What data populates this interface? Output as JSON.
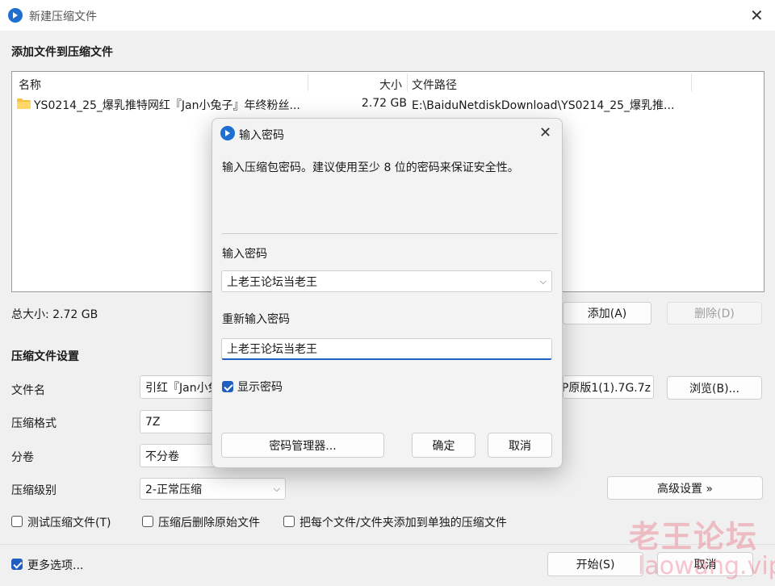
{
  "window": {
    "title": "新建压缩文件"
  },
  "section_add": {
    "title": "添加文件到压缩文件"
  },
  "file_list": {
    "columns": {
      "name": "名称",
      "size": "大小",
      "path": "文件路径"
    },
    "rows": [
      {
        "name": "YS0214_25_爆乳推特网红『Jan小兔子』年终粉丝...",
        "size": "2.72 GB",
        "path": "E:\\BaiduNetdiskDownload\\YS0214_25_爆乳推..."
      }
    ]
  },
  "total_size": "总大小: 2.72 GB",
  "buttons": {
    "add": "添加(A)",
    "delete": "删除(D)",
    "browse": "浏览(B)...",
    "advanced": "高级设置 »",
    "start": "开始(S)",
    "cancel": "取消"
  },
  "settings": {
    "title": "压缩文件设置",
    "filename_label": "文件名",
    "filename_visible_left": "引红『Jan小兔",
    "filename_visible_right": "P原版1(1).7G.7z",
    "format_label": "压缩格式",
    "format_value": "7Z",
    "volume_label": "分卷",
    "volume_value": "不分卷",
    "level_label": "压缩级别",
    "level_value": "2-正常压缩"
  },
  "options": {
    "test": "测试压缩文件(T)",
    "delete_after": "压缩后删除原始文件",
    "separate": "把每个文件/文件夹添加到单独的压缩文件",
    "more": "更多选项..."
  },
  "dialog": {
    "title": "输入密码",
    "message": "输入压缩包密码。建议使用至少 8 位的密码来保证安全性。",
    "password_label": "输入密码",
    "password_value": "上老王论坛当老王",
    "confirm_label": "重新输入密码",
    "confirm_value": "上老王论坛当老王",
    "show_password": "显示密码",
    "manager_button": "密码管理器...",
    "ok_button": "确定",
    "cancel_button": "取消"
  },
  "watermark": {
    "line1": "老王论坛",
    "line2": "laowang.vip"
  },
  "colors": {
    "accent": "#1f5fbf",
    "folder": "#f5c342"
  },
  "icons": {
    "app": "app-logo-icon",
    "folder": "folder-icon",
    "close": "close-icon",
    "caret": "chevron-down-icon",
    "check": "checkbox-checked-icon"
  }
}
